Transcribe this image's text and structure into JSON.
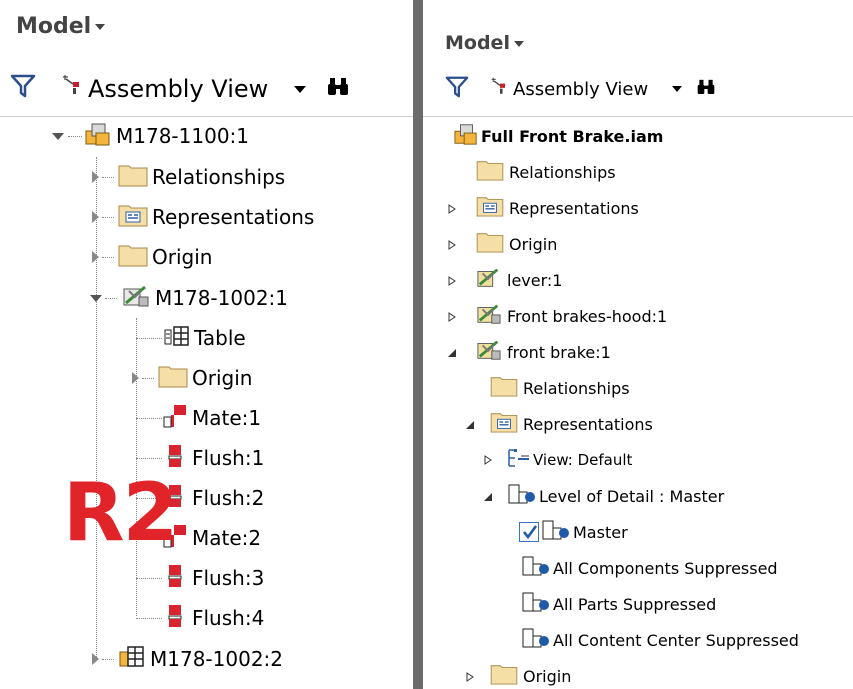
{
  "left": {
    "header": "Model",
    "toolbar_view": "Assembly View",
    "rows": [
      "M178-1100:1",
      "Relationships",
      "Representations",
      "Origin",
      "M178-1002:1",
      "Table",
      "Origin",
      "Mate:1",
      "Flush:1",
      "Flush:2",
      "Mate:2",
      "Flush:3",
      "Flush:4",
      "M178-1002:2"
    ],
    "overlay_label": "R2"
  },
  "right": {
    "header": "Model",
    "toolbar_view": "Assembly View",
    "rows": [
      "Full Front Brake.iam",
      "Relationships",
      "Representations",
      "Origin",
      "lever:1",
      "Front brakes-hood:1",
      "front brake:1",
      "Relationships",
      "Representations",
      "View: Default",
      "Level of Detail : Master",
      "Master",
      "All Components Suppressed",
      "All Parts Suppressed",
      "All Content Center Suppressed",
      "Origin"
    ]
  },
  "colors": {
    "folder": "#f5dfa6",
    "constraint_red": "#d9232e",
    "annotation_red": "#e0242a",
    "divider": "#6b6b6b"
  }
}
